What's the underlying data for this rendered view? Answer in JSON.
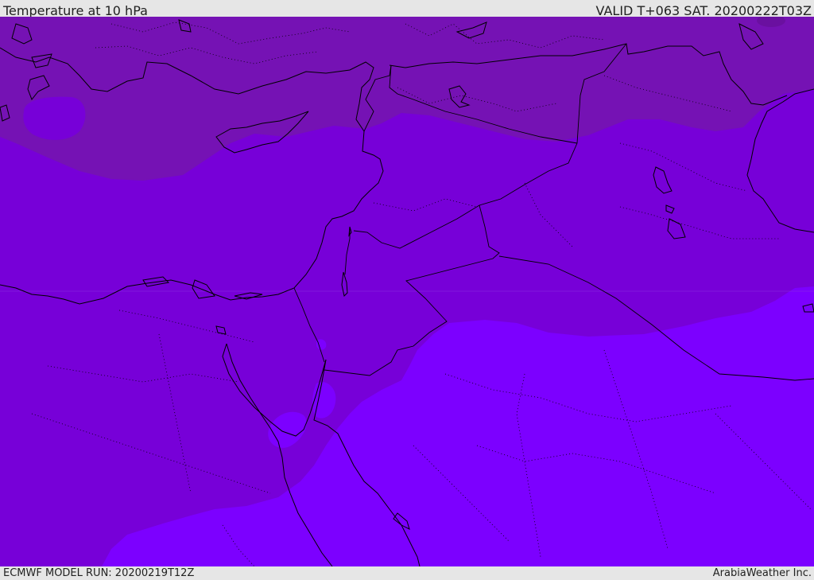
{
  "header": {
    "title": "Temperature at 10 hPa",
    "valid": "VALID T+063 SAT. 20200222T03Z"
  },
  "footer": {
    "model_run": "ECMWF MODEL RUN: 20200219T12Z",
    "credit": "ArabiaWeather Inc."
  },
  "colors": {
    "band_cold": "#7512b4",
    "band_mid": "#7700d8",
    "band_warm": "#7c00ff",
    "bar_background": "#e6e6e6",
    "coastline": "#000000"
  }
}
